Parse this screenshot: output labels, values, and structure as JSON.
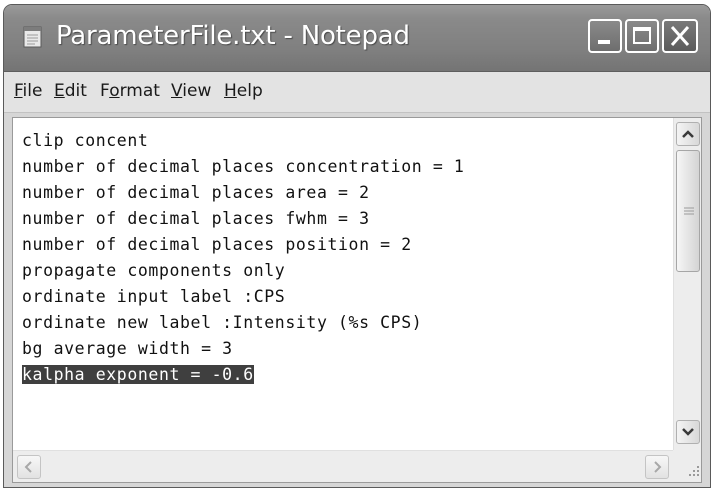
{
  "window": {
    "title": "ParameterFile.txt - Notepad",
    "app_icon": "notepad-icon"
  },
  "titlebar_buttons": {
    "minimize_icon": "minimize-icon",
    "maximize_icon": "maximize-icon",
    "close_icon": "close-icon"
  },
  "menu": {
    "items": [
      {
        "accel": "F",
        "rest": "ile"
      },
      {
        "accel": "E",
        "rest": "dit"
      },
      {
        "pre": "F",
        "accel": "o",
        "rest": "rmat"
      },
      {
        "accel": "V",
        "rest": "iew"
      },
      {
        "accel": "H",
        "rest": "elp"
      }
    ]
  },
  "editor": {
    "lines": [
      "clip concent",
      "number of decimal places concentration = 1",
      "number of decimal places area = 2",
      "number of decimal places fwhm = 3",
      "number of decimal places position = 2",
      "propagate components only",
      "ordinate input label :CPS",
      "ordinate new label :Intensity (%s CPS)",
      "bg average width = 3",
      "kalpha exponent = -0.6"
    ],
    "selected_line_index": 9
  },
  "colors": {
    "titlebar": "#808080",
    "selection_bg": "#3f3f3f",
    "selection_fg": "#ffffff",
    "menubar": "#e3e3e3"
  }
}
